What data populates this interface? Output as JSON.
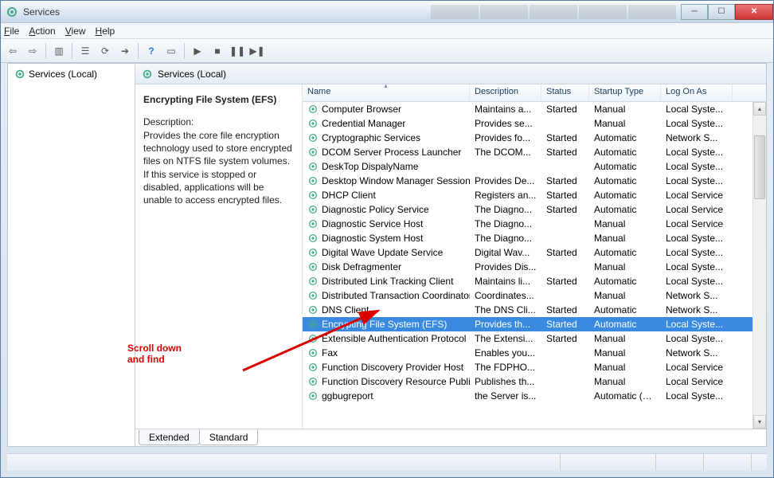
{
  "window": {
    "title": "Services"
  },
  "menu": {
    "file": "File",
    "action": "Action",
    "view": "View",
    "help": "Help"
  },
  "tree": {
    "root": "Services (Local)"
  },
  "content_header": "Services (Local)",
  "detail": {
    "title": "Encrypting File System (EFS)",
    "desc_label": "Description:",
    "desc": "Provides the core file encryption technology used to store encrypted files on NTFS file system volumes. If this service is stopped or disabled, applications will be unable to access encrypted files."
  },
  "columns": {
    "name": "Name",
    "description": "Description",
    "status": "Status",
    "startup": "Startup Type",
    "logon": "Log On As"
  },
  "services": [
    {
      "name": "Computer Browser",
      "desc": "Maintains a...",
      "status": "Started",
      "startup": "Manual",
      "logon": "Local Syste..."
    },
    {
      "name": "Credential Manager",
      "desc": "Provides se...",
      "status": "",
      "startup": "Manual",
      "logon": "Local Syste..."
    },
    {
      "name": "Cryptographic Services",
      "desc": "Provides fo...",
      "status": "Started",
      "startup": "Automatic",
      "logon": "Network S..."
    },
    {
      "name": "DCOM Server Process Launcher",
      "desc": "The DCOM...",
      "status": "Started",
      "startup": "Automatic",
      "logon": "Local Syste..."
    },
    {
      "name": "DeskTop DispalyName",
      "desc": "",
      "status": "",
      "startup": "Automatic",
      "logon": "Local Syste..."
    },
    {
      "name": "Desktop Window Manager Session...",
      "desc": "Provides De...",
      "status": "Started",
      "startup": "Automatic",
      "logon": "Local Syste..."
    },
    {
      "name": "DHCP Client",
      "desc": "Registers an...",
      "status": "Started",
      "startup": "Automatic",
      "logon": "Local Service"
    },
    {
      "name": "Diagnostic Policy Service",
      "desc": "The Diagno...",
      "status": "Started",
      "startup": "Automatic",
      "logon": "Local Service"
    },
    {
      "name": "Diagnostic Service Host",
      "desc": "The Diagno...",
      "status": "",
      "startup": "Manual",
      "logon": "Local Service"
    },
    {
      "name": "Diagnostic System Host",
      "desc": "The Diagno...",
      "status": "",
      "startup": "Manual",
      "logon": "Local Syste..."
    },
    {
      "name": "Digital Wave Update Service",
      "desc": "Digital Wav...",
      "status": "Started",
      "startup": "Automatic",
      "logon": "Local Syste..."
    },
    {
      "name": "Disk Defragmenter",
      "desc": "Provides Dis...",
      "status": "",
      "startup": "Manual",
      "logon": "Local Syste..."
    },
    {
      "name": "Distributed Link Tracking Client",
      "desc": "Maintains li...",
      "status": "Started",
      "startup": "Automatic",
      "logon": "Local Syste..."
    },
    {
      "name": "Distributed Transaction Coordinator",
      "desc": "Coordinates...",
      "status": "",
      "startup": "Manual",
      "logon": "Network S..."
    },
    {
      "name": "DNS Client",
      "desc": "The DNS Cli...",
      "status": "Started",
      "startup": "Automatic",
      "logon": "Network S..."
    },
    {
      "name": "Encrypting File System (EFS)",
      "desc": "Provides th...",
      "status": "Started",
      "startup": "Automatic",
      "logon": "Local Syste...",
      "selected": true
    },
    {
      "name": "Extensible Authentication Protocol",
      "desc": "The Extensi...",
      "status": "Started",
      "startup": "Manual",
      "logon": "Local Syste..."
    },
    {
      "name": "Fax",
      "desc": "Enables you...",
      "status": "",
      "startup": "Manual",
      "logon": "Network S..."
    },
    {
      "name": "Function Discovery Provider Host",
      "desc": "The FDPHO...",
      "status": "",
      "startup": "Manual",
      "logon": "Local Service"
    },
    {
      "name": "Function Discovery Resource Publi...",
      "desc": "Publishes th...",
      "status": "",
      "startup": "Manual",
      "logon": "Local Service"
    },
    {
      "name": "ggbugreport",
      "desc": "the Server is...",
      "status": "",
      "startup": "Automatic (D...",
      "logon": "Local Syste..."
    }
  ],
  "tabs": {
    "extended": "Extended",
    "standard": "Standard"
  },
  "annotation": {
    "line1": "Scroll down",
    "line2": "and find"
  }
}
